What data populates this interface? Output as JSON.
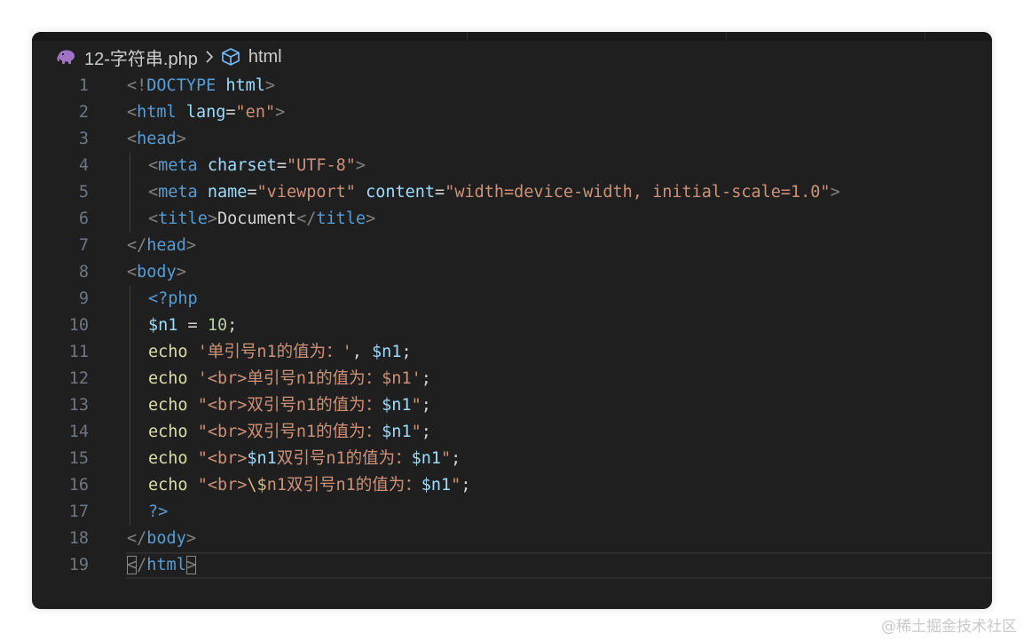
{
  "breadcrumb": {
    "file": "12-字符串.php",
    "symbol": "html",
    "file_icon": "php-elephant-icon",
    "symbol_icon": "cube-icon",
    "separator_icon": "chevron-right-icon"
  },
  "lines": [
    {
      "n": "1",
      "indent": 0,
      "tokens": [
        [
          "p",
          "<!"
        ],
        [
          "t",
          "DOCTYPE"
        ],
        [
          "txt",
          " "
        ],
        [
          "a",
          "html"
        ],
        [
          "p",
          ">"
        ]
      ]
    },
    {
      "n": "2",
      "indent": 0,
      "tokens": [
        [
          "p",
          "<"
        ],
        [
          "t",
          "html"
        ],
        [
          "txt",
          " "
        ],
        [
          "a",
          "lang"
        ],
        [
          "txt",
          "="
        ],
        [
          "s",
          "\"en\""
        ],
        [
          "p",
          ">"
        ]
      ]
    },
    {
      "n": "3",
      "indent": 0,
      "tokens": [
        [
          "p",
          "<"
        ],
        [
          "t",
          "head"
        ],
        [
          "p",
          ">"
        ]
      ]
    },
    {
      "n": "4",
      "indent": 1,
      "tokens": [
        [
          "p",
          "<"
        ],
        [
          "t",
          "meta"
        ],
        [
          "txt",
          " "
        ],
        [
          "a",
          "charset"
        ],
        [
          "txt",
          "="
        ],
        [
          "s",
          "\"UTF-8\""
        ],
        [
          "p",
          ">"
        ]
      ]
    },
    {
      "n": "5",
      "indent": 1,
      "tokens": [
        [
          "p",
          "<"
        ],
        [
          "t",
          "meta"
        ],
        [
          "txt",
          " "
        ],
        [
          "a",
          "name"
        ],
        [
          "txt",
          "="
        ],
        [
          "s",
          "\"viewport\""
        ],
        [
          "txt",
          " "
        ],
        [
          "a",
          "content"
        ],
        [
          "txt",
          "="
        ],
        [
          "s",
          "\"width=device-width, initial-scale=1.0\""
        ],
        [
          "p",
          ">"
        ]
      ]
    },
    {
      "n": "6",
      "indent": 1,
      "tokens": [
        [
          "p",
          "<"
        ],
        [
          "t",
          "title"
        ],
        [
          "p",
          ">"
        ],
        [
          "txt",
          "Document"
        ],
        [
          "p",
          "</"
        ],
        [
          "t",
          "title"
        ],
        [
          "p",
          ">"
        ]
      ]
    },
    {
      "n": "7",
      "indent": 0,
      "tokens": [
        [
          "p",
          "</"
        ],
        [
          "t",
          "head"
        ],
        [
          "p",
          ">"
        ]
      ]
    },
    {
      "n": "8",
      "indent": 0,
      "tokens": [
        [
          "p",
          "<"
        ],
        [
          "t",
          "body"
        ],
        [
          "p",
          ">"
        ]
      ]
    },
    {
      "n": "9",
      "indent": 1,
      "tokens": [
        [
          "t",
          "<?php"
        ]
      ]
    },
    {
      "n": "10",
      "indent": 1,
      "tokens": [
        [
          "v",
          "$n1"
        ],
        [
          "txt",
          " = "
        ],
        [
          "n",
          "10"
        ],
        [
          "txt",
          ";"
        ]
      ]
    },
    {
      "n": "11",
      "indent": 1,
      "tokens": [
        [
          "f",
          "echo"
        ],
        [
          "txt",
          " "
        ],
        [
          "s",
          "'单引号n1的值为：'"
        ],
        [
          "txt",
          ", "
        ],
        [
          "v",
          "$n1"
        ],
        [
          "txt",
          ";"
        ]
      ]
    },
    {
      "n": "12",
      "indent": 1,
      "tokens": [
        [
          "f",
          "echo"
        ],
        [
          "txt",
          " "
        ],
        [
          "s",
          "'<br>单引号n1的值为：$n1'"
        ],
        [
          "txt",
          ";"
        ]
      ]
    },
    {
      "n": "13",
      "indent": 1,
      "tokens": [
        [
          "f",
          "echo"
        ],
        [
          "txt",
          " "
        ],
        [
          "s",
          "\"<br>双引号n1的值为："
        ],
        [
          "v",
          "$n1"
        ],
        [
          "s",
          "\""
        ],
        [
          "txt",
          ";"
        ]
      ]
    },
    {
      "n": "14",
      "indent": 1,
      "tokens": [
        [
          "f",
          "echo"
        ],
        [
          "txt",
          " "
        ],
        [
          "s",
          "\"<br>双引号n1的值为："
        ],
        [
          "v",
          "$n1"
        ],
        [
          "s",
          "\""
        ],
        [
          "txt",
          ";"
        ]
      ]
    },
    {
      "n": "15",
      "indent": 1,
      "tokens": [
        [
          "f",
          "echo"
        ],
        [
          "txt",
          " "
        ],
        [
          "s",
          "\"<br>"
        ],
        [
          "v",
          "$n1"
        ],
        [
          "s",
          "双引号n1的值为："
        ],
        [
          "v",
          "$n1"
        ],
        [
          "s",
          "\""
        ],
        [
          "txt",
          ";"
        ]
      ]
    },
    {
      "n": "16",
      "indent": 1,
      "tokens": [
        [
          "f",
          "echo"
        ],
        [
          "txt",
          " "
        ],
        [
          "s",
          "\"<br>"
        ],
        [
          "e",
          "\\$"
        ],
        [
          "s",
          "n1双引号n1的值为："
        ],
        [
          "v",
          "$n1"
        ],
        [
          "s",
          "\""
        ],
        [
          "txt",
          ";"
        ]
      ]
    },
    {
      "n": "17",
      "indent": 1,
      "tokens": [
        [
          "t",
          "?>"
        ]
      ]
    },
    {
      "n": "18",
      "indent": 0,
      "tokens": [
        [
          "p",
          "</"
        ],
        [
          "t",
          "body"
        ],
        [
          "p",
          ">"
        ]
      ]
    },
    {
      "n": "19",
      "indent": 0,
      "current": true,
      "tokens": [
        [
          "p bm",
          "<"
        ],
        [
          "p",
          "/"
        ],
        [
          "t",
          "html"
        ],
        [
          "p bm",
          ">"
        ]
      ]
    }
  ],
  "watermark": "@稀土掘金技术社区"
}
